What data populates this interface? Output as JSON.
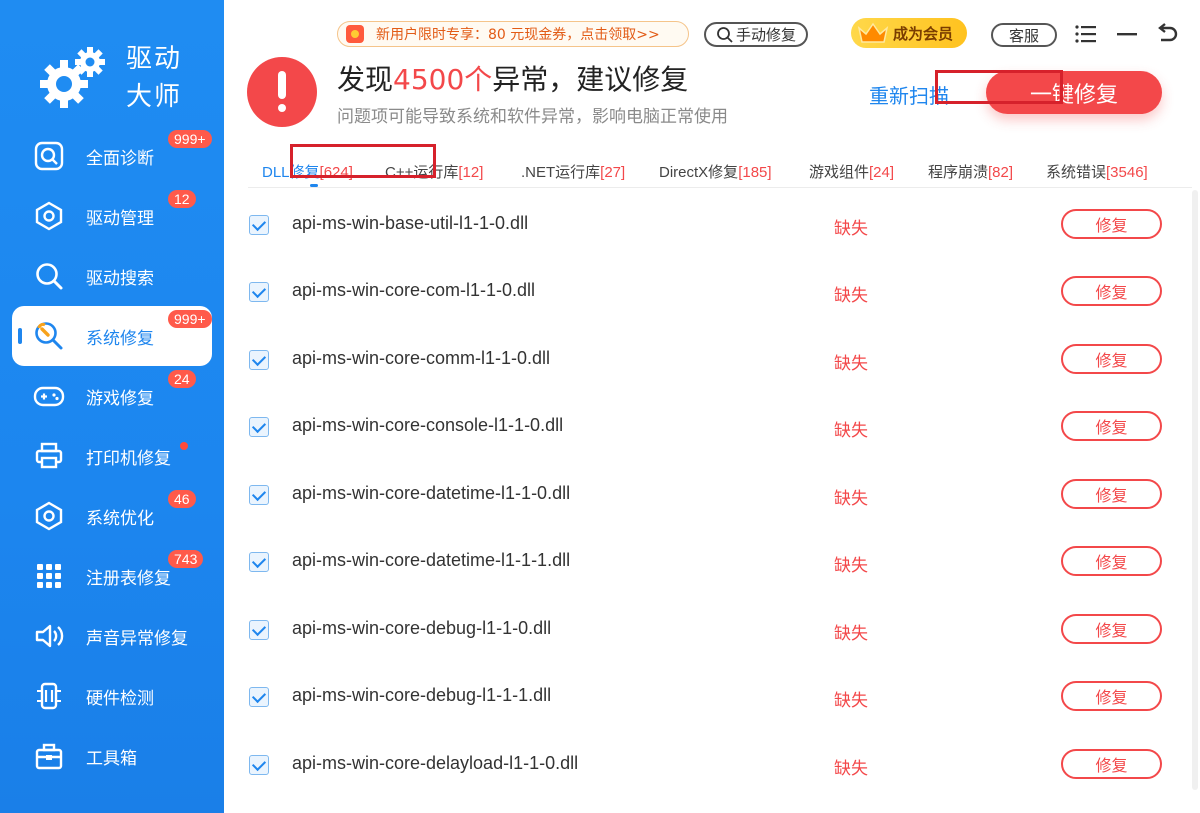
{
  "brand": {
    "name_line1": "驱动",
    "name_line2": "大师"
  },
  "sidebar": {
    "items": [
      {
        "label": "全面诊断",
        "badge": "999+",
        "icon": "diagnose-icon"
      },
      {
        "label": "驱动管理",
        "badge": "12",
        "icon": "hexagon-icon"
      },
      {
        "label": "驱动搜索",
        "badge": "",
        "icon": "search-icon"
      },
      {
        "label": "系统修复",
        "badge": "999+",
        "icon": "wrench-icon",
        "active": true
      },
      {
        "label": "游戏修复",
        "badge": "24",
        "icon": "gamepad-icon"
      },
      {
        "label": "打印机修复",
        "badge": "",
        "icon": "printer-icon",
        "dot": true
      },
      {
        "label": "系统优化",
        "badge": "46",
        "icon": "hexagon-icon"
      },
      {
        "label": "注册表修复",
        "badge": "743",
        "icon": "grid-icon"
      },
      {
        "label": "声音异常修复",
        "badge": "",
        "icon": "speaker-icon"
      },
      {
        "label": "硬件检测",
        "badge": "",
        "icon": "chip-icon"
      },
      {
        "label": "工具箱",
        "badge": "",
        "icon": "toolbox-icon"
      }
    ]
  },
  "topbar": {
    "promo": "新用户限时专享：80 元现金券，点击领取>>",
    "manual_repair": "手动修复",
    "vip": "成为会员",
    "service": "客服"
  },
  "summary": {
    "prefix": "发现",
    "count": "4500个",
    "suffix": "异常，建议修复",
    "subtitle": "问题项可能导致系统和软件异常，影响电脑正常使用",
    "rescan": "重新扫描",
    "onekey": "一键修复"
  },
  "tabs": [
    {
      "label": "DLL修复",
      "count": "[624]"
    },
    {
      "label": "C++运行库",
      "count": "[12]"
    },
    {
      "label": ".NET运行库",
      "count": "[27]"
    },
    {
      "label": "DirectX修复",
      "count": "[185]"
    },
    {
      "label": "游戏组件",
      "count": "[24]"
    },
    {
      "label": "程序崩溃",
      "count": "[82]"
    },
    {
      "label": "系统错误",
      "count": "[3546]"
    }
  ],
  "list": {
    "status_label": "缺失",
    "fix_label": "修复",
    "rows": [
      "api-ms-win-base-util-l1-1-0.dll",
      "api-ms-win-core-com-l1-1-0.dll",
      "api-ms-win-core-comm-l1-1-0.dll",
      "api-ms-win-core-console-l1-1-0.dll",
      "api-ms-win-core-datetime-l1-1-0.dll",
      "api-ms-win-core-datetime-l1-1-1.dll",
      "api-ms-win-core-debug-l1-1-0.dll",
      "api-ms-win-core-debug-l1-1-1.dll",
      "api-ms-win-core-delayload-l1-1-0.dll"
    ]
  },
  "colors": {
    "brand_blue": "#1f86ee",
    "alert_red": "#f3484a",
    "vip_gold": "#ffc21f"
  }
}
